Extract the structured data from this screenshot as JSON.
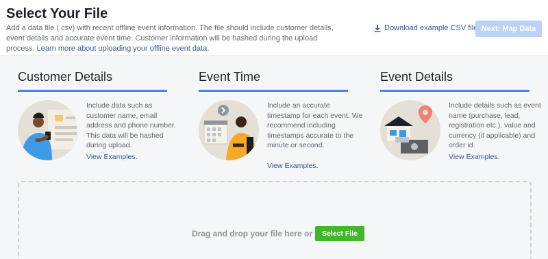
{
  "header": {
    "title": "Select Your File",
    "description": "Add a data file (.csv) with recent offline event information. The file should include customer details, event details and accurate event time. Customer information will be hashed during the upload process.",
    "learn_more_link": "Learn more about uploading your offline event data.",
    "download_link": "Download example CSV file",
    "download_icon": "download-icon",
    "next_button": "Next: Map Data"
  },
  "cards": [
    {
      "title": "Customer Details",
      "text": "Include data such as customer name, email address and phone number. This data will be hashed during upload.",
      "link": "View Examples.",
      "illustration": "person-with-phone-illustration"
    },
    {
      "title": "Event Time",
      "text": "Include an accurate timestamp for each event. We recommend including timestamps accurate to the minute or second.",
      "link": "View Examples.",
      "illustration": "calendar-clock-illustration"
    },
    {
      "title": "Event Details",
      "text": "Include details such as event name (purchase, lead, registration etc.), value and currency (if applicable) and order id.",
      "link": "View Examples.",
      "illustration": "store-location-illustration"
    }
  ],
  "dropzone": {
    "text": "Drag and drop your file here or",
    "button": "Select File"
  },
  "colors": {
    "accent": "#4a7ee6",
    "link": "#385898",
    "next_disabled": "#bcd3f7",
    "select_green": "#42b72a"
  }
}
